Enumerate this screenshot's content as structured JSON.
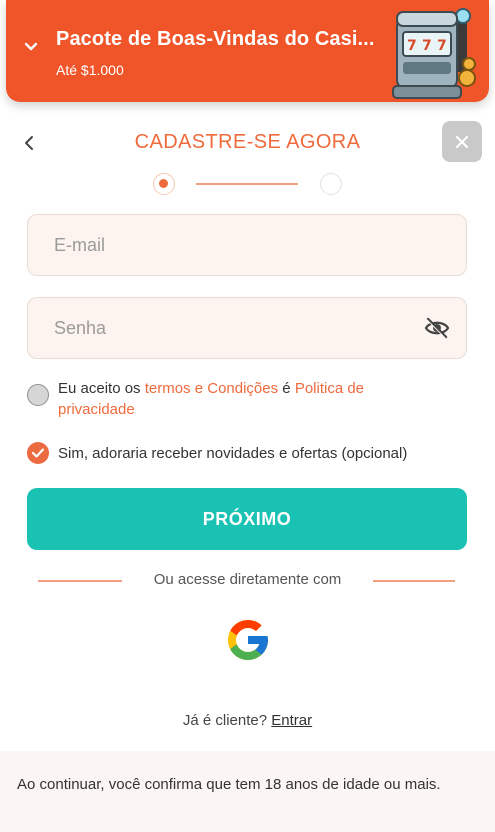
{
  "promo": {
    "title": "Pacote de Boas-Vindas do Casi...",
    "subtitle": "Até $1.000",
    "image": "slot-machine-illustration"
  },
  "header": {
    "title": "CADASTRE-SE AGORA",
    "back_icon": "chevron-left-icon",
    "close_icon": "close-icon"
  },
  "stepper": {
    "current_step": 1,
    "total_steps": 2
  },
  "form": {
    "email_placeholder": "E-mail",
    "password_placeholder": "Senha",
    "password_toggle_icon": "eye-off-icon"
  },
  "consent": {
    "terms_prefix": "Eu aceito os ",
    "terms_link": "termos e Condições",
    "terms_middle": " é ",
    "privacy_link": "Politica de privacidade",
    "terms_checked": false,
    "offers_label": "Sim, adoraria receber novidades e ofertas (opcional)",
    "offers_checked": true
  },
  "actions": {
    "next_label": "PRÓXIMO"
  },
  "social": {
    "divider_text": "Ou acesse diretamente com",
    "provider_icon": "google-icon"
  },
  "login": {
    "prompt": "Já é cliente?",
    "link": "Entrar"
  },
  "footer": {
    "disclaimer": "Ao continuar, você confirma que tem 18 anos de idade ou mais."
  },
  "colors": {
    "brand_orange": "#f0552a",
    "accent_orange": "#ef6a3c",
    "primary_teal": "#19c2b2",
    "input_bg": "#fdf4ef"
  }
}
